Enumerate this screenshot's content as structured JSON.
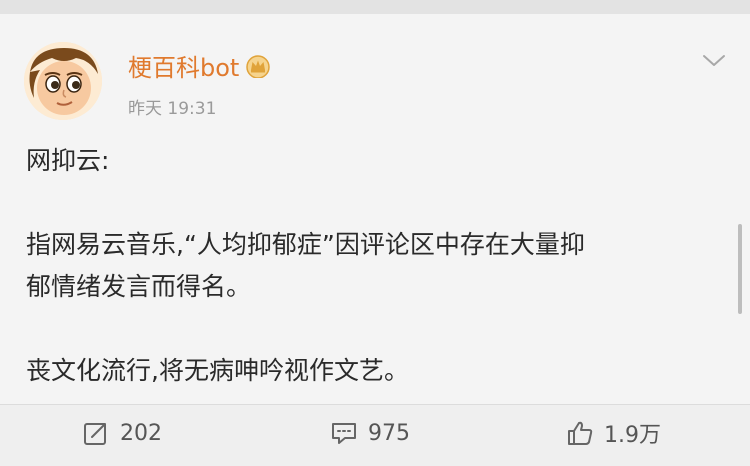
{
  "post": {
    "author": "梗百科bot",
    "timestamp": "昨天 19:31",
    "body": {
      "title_line": "网抑云:",
      "paragraph_1_line_1": "指网易云音乐,“人均抑郁症”因评论区中存在大量抑",
      "paragraph_1_line_2": "郁情绪发言而得名。",
      "paragraph_2": "丧文化流行,将无病呻吟视作文艺。"
    }
  },
  "actions": {
    "repost_count": "202",
    "comment_count": "975",
    "like_count": "1.9万"
  },
  "icons": {
    "author_badge": "crown-icon",
    "menu": "chevron-down-icon",
    "repost": "repost-icon",
    "comment": "comment-icon",
    "like": "thumbs-up-icon"
  },
  "colors": {
    "author_name": "#e07a2e",
    "badge": "#e0a33a",
    "card_background": "#f4f4f4",
    "text": "#2a2a2a",
    "muted_text": "#9a9a9a"
  }
}
